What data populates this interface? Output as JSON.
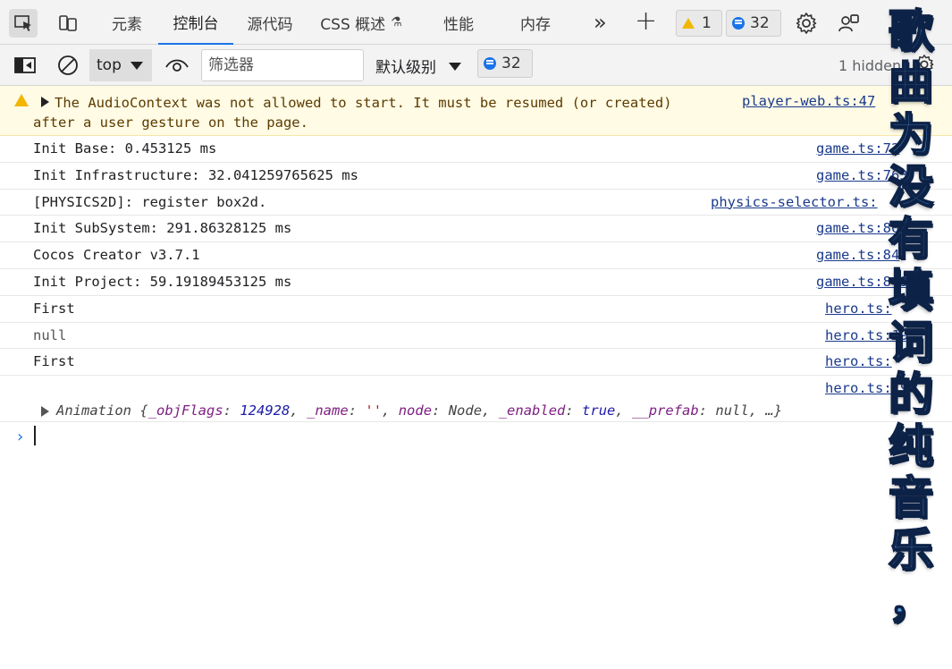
{
  "tabs": [
    {
      "label": "元素"
    },
    {
      "label": "控制台"
    },
    {
      "label": "源代码"
    },
    {
      "label": "CSS 概述"
    },
    {
      "label": "性能"
    },
    {
      "label": "内存"
    }
  ],
  "badges": {
    "warnings": "1",
    "messages": "32"
  },
  "toolbar": {
    "context": "top",
    "filter_placeholder": "筛选器",
    "level": "默认级别",
    "messages_count": "32",
    "hidden": "1 hidden"
  },
  "warning": {
    "text": "The AudioContext was not allowed to start. It must be resumed (or created) after a user gesture on the page.",
    "source": "player-web.ts:47"
  },
  "logs": [
    {
      "text": "Init Base: 0.453125 ms",
      "source": "game.ts:72"
    },
    {
      "text": "Init Infrastructure: 32.041259765625 ms",
      "source": "game.ts:763"
    },
    {
      "text": "[PHYSICS2D]: register box2d.",
      "source": "physics-selector.ts:"
    },
    {
      "text": "Init SubSystem: 291.86328125 ms",
      "source": "game.ts:80"
    },
    {
      "text": "Cocos Creator v3.7.1",
      "source": "game.ts:84"
    },
    {
      "text": "Init Project: 59.19189453125 ms",
      "source": "game.ts:849"
    },
    {
      "text": "First",
      "source": "hero.ts:"
    },
    {
      "text": "null",
      "source": "hero.ts:19"
    },
    {
      "text": "First",
      "source": "hero.ts:"
    }
  ],
  "object_log": {
    "source": "hero.ts:19",
    "class": "Animation",
    "k1": "_objFlags",
    "v1": "124928",
    "k2": "_name",
    "v2": "''",
    "k3": "node",
    "v3": "Node",
    "k4": "_enabled",
    "v4": "true",
    "k5": "__prefab",
    "v5": "null",
    "tail": "…}"
  },
  "overlay_subtitle": [
    "歌",
    "曲",
    "为",
    "没",
    "有",
    "填",
    "词",
    "的",
    "纯",
    "音",
    "乐",
    "，"
  ],
  "colors": {
    "accent": "#1a73e8",
    "warning_bg": "#fffbe5",
    "link": "#1a3a8c"
  }
}
